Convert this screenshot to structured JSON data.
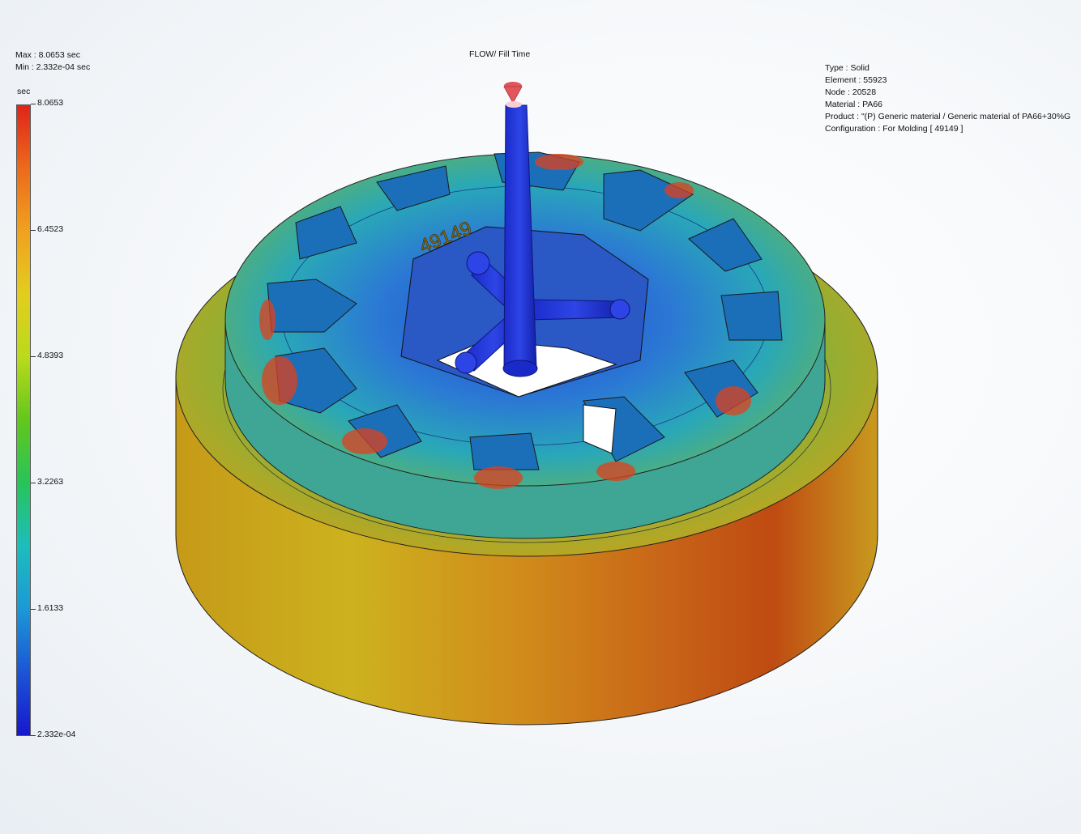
{
  "header": {
    "max_label": "Max : 8.0653 sec",
    "min_label": "Min : 2.332e-04 sec",
    "plot_title": "FLOW/ Fill Time"
  },
  "legend": {
    "unit": "sec",
    "ticks": [
      "8.0653",
      "6.4523",
      "4.8393",
      "3.2263",
      "1.6133",
      "2.332e-04"
    ],
    "colors": {
      "max": "#e0241c",
      "high": "#f0a11f",
      "mid": "#62c71c",
      "low": "#1dbdbd",
      "min": "#1717cf"
    }
  },
  "model_info": {
    "type": "Type : Solid",
    "element": "Element : 55923",
    "node": "Node : 20528",
    "material": "Material : PA66",
    "product": "Product :   \"(P)  Generic material / Generic material of PA66+30%G",
    "configuration": "Configuration : For Molding [ 49149 ]"
  },
  "model": {
    "engraved_text": "49149"
  }
}
